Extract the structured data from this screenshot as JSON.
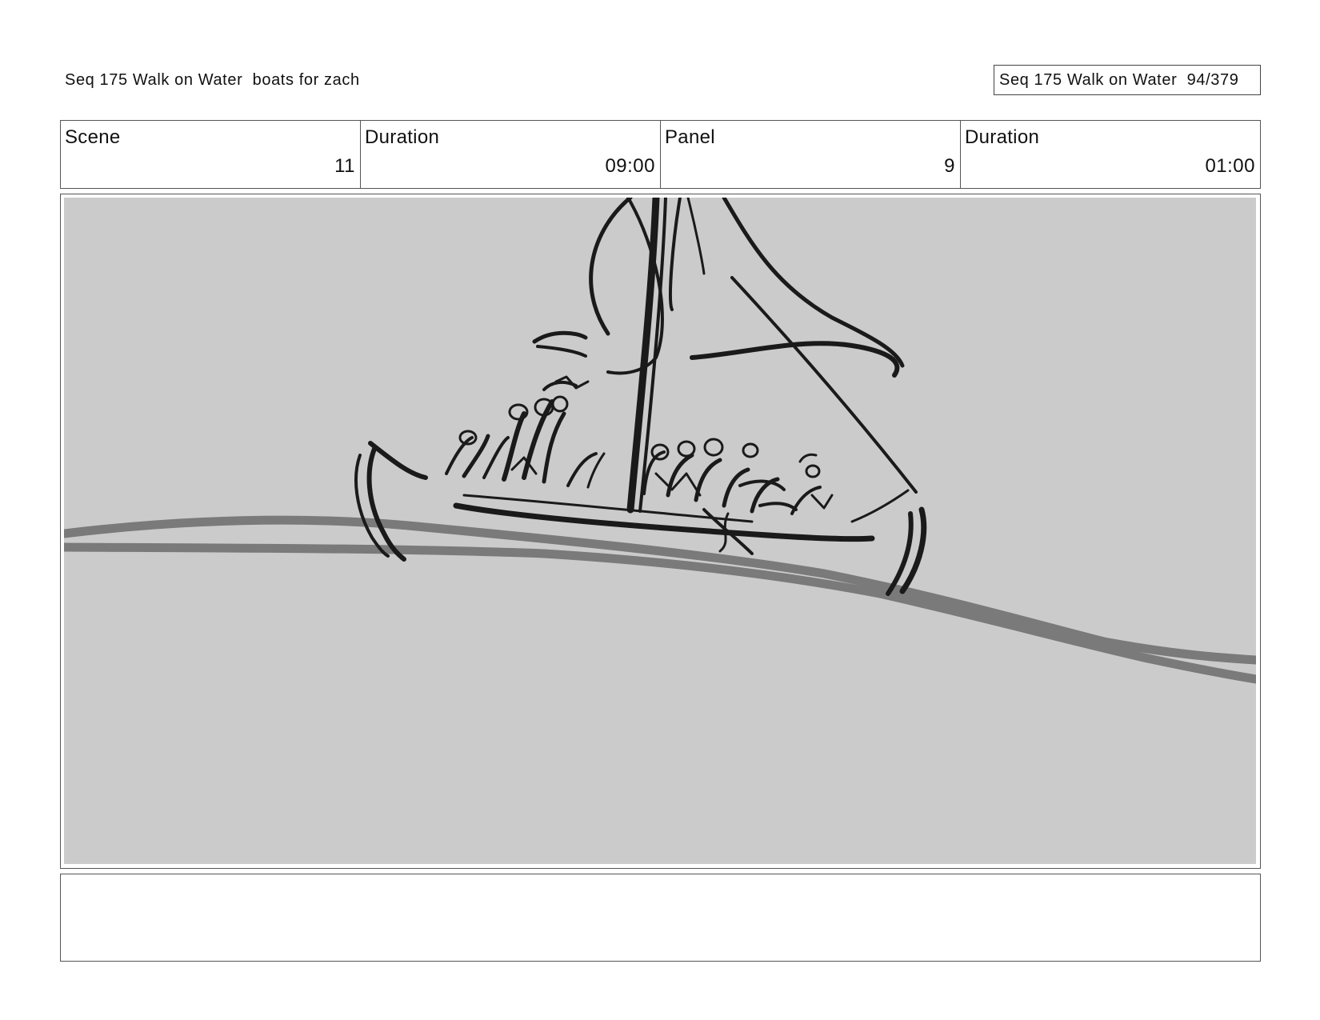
{
  "header": {
    "left_title": "Seq 175 Walk on Water  boats for zach",
    "right_title": "Seq 175 Walk on Water  94/379"
  },
  "info": {
    "scene_label": "Scene",
    "scene_value": "11",
    "scene_duration_label": "Duration",
    "scene_duration_value": "09:00",
    "panel_label": "Panel",
    "panel_value": "9",
    "panel_duration_label": "Duration",
    "panel_duration_value": "01:00"
  },
  "panel": {
    "background_color": "#cbcbcb",
    "stroke_color": "#1a1a1a",
    "water_color": "#7a7a7a"
  },
  "notes": {
    "text": ""
  }
}
